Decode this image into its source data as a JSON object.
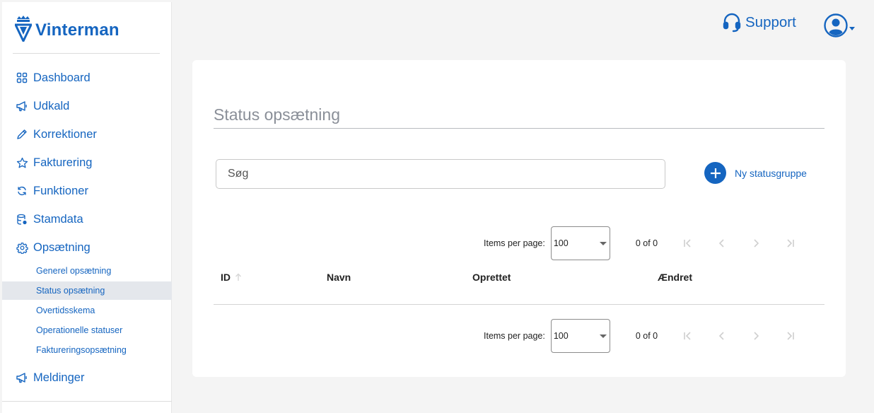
{
  "brand": {
    "name": "Vinterman",
    "color": "#1565c0",
    "icon": "crown-triangle-logo-icon"
  },
  "nav": {
    "items": [
      {
        "label": "Dashboard",
        "icon": "grid-icon"
      },
      {
        "label": "Udkald",
        "icon": "megaphone-icon"
      },
      {
        "label": "Korrektioner",
        "icon": "pencil-icon"
      },
      {
        "label": "Fakturering",
        "icon": "star-icon"
      },
      {
        "label": "Funktioner",
        "icon": "refresh-icon"
      },
      {
        "label": "Stamdata",
        "icon": "database-icon"
      },
      {
        "label": "Opsætning",
        "icon": "gear-icon"
      }
    ],
    "sub_items": [
      {
        "label": "Generel opsætning"
      },
      {
        "label": "Status opsætning",
        "active": true
      },
      {
        "label": "Overtidsskema"
      },
      {
        "label": "Operationelle statuser"
      },
      {
        "label": "Faktureringsopsætning"
      }
    ],
    "extra_item": {
      "label": "Meldinger",
      "icon": "megaphone-icon"
    }
  },
  "topbar": {
    "support_label": "Support",
    "support_icon": "headset-icon",
    "user_icon": "account-circle-icon"
  },
  "main": {
    "title": "Status opsætning",
    "search": {
      "placeholder": "Søg",
      "value": ""
    },
    "add_button_label": "Ny statusgruppe",
    "paginator": {
      "items_label": "Items per page:",
      "page_size": "100",
      "range": "0 of 0"
    },
    "table": {
      "columns": [
        {
          "label": "ID",
          "sortable": true
        },
        {
          "label": "Navn"
        },
        {
          "label": "Oprettet"
        },
        {
          "label": "Ændret"
        }
      ],
      "rows": []
    }
  }
}
